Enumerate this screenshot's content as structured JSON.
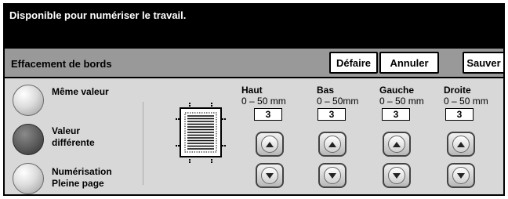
{
  "status": {
    "message": "Disponible pour numériser le travail."
  },
  "header": {
    "title": "Effacement de bords",
    "undo_label": "Défaire",
    "cancel_label": "Annuler",
    "save_label": "Sauver"
  },
  "options": [
    {
      "label_line1": "Même valeur",
      "label_line2": "",
      "selected": false
    },
    {
      "label_line1": "Valeur",
      "label_line2": "différente",
      "selected": true
    },
    {
      "label_line1": "Numérisation",
      "label_line2": "Pleine page",
      "selected": false
    }
  ],
  "edges": [
    {
      "name": "Haut",
      "range": "0 – 50 mm",
      "value": "3"
    },
    {
      "name": "Bas",
      "range": "0 – 50mm",
      "value": "3"
    },
    {
      "name": "Gauche",
      "range": "0 – 50 mm",
      "value": "3"
    },
    {
      "name": "Droite",
      "range": "0 – 50 mm",
      "value": "3"
    }
  ],
  "icons": {
    "up": "arrow-up-icon",
    "down": "arrow-down-icon",
    "diagram": "page-edge-diagram-icon"
  },
  "colors": {
    "status_bg": "#000000",
    "header_bg": "#999999",
    "panel_bg": "#d8d8d8"
  }
}
